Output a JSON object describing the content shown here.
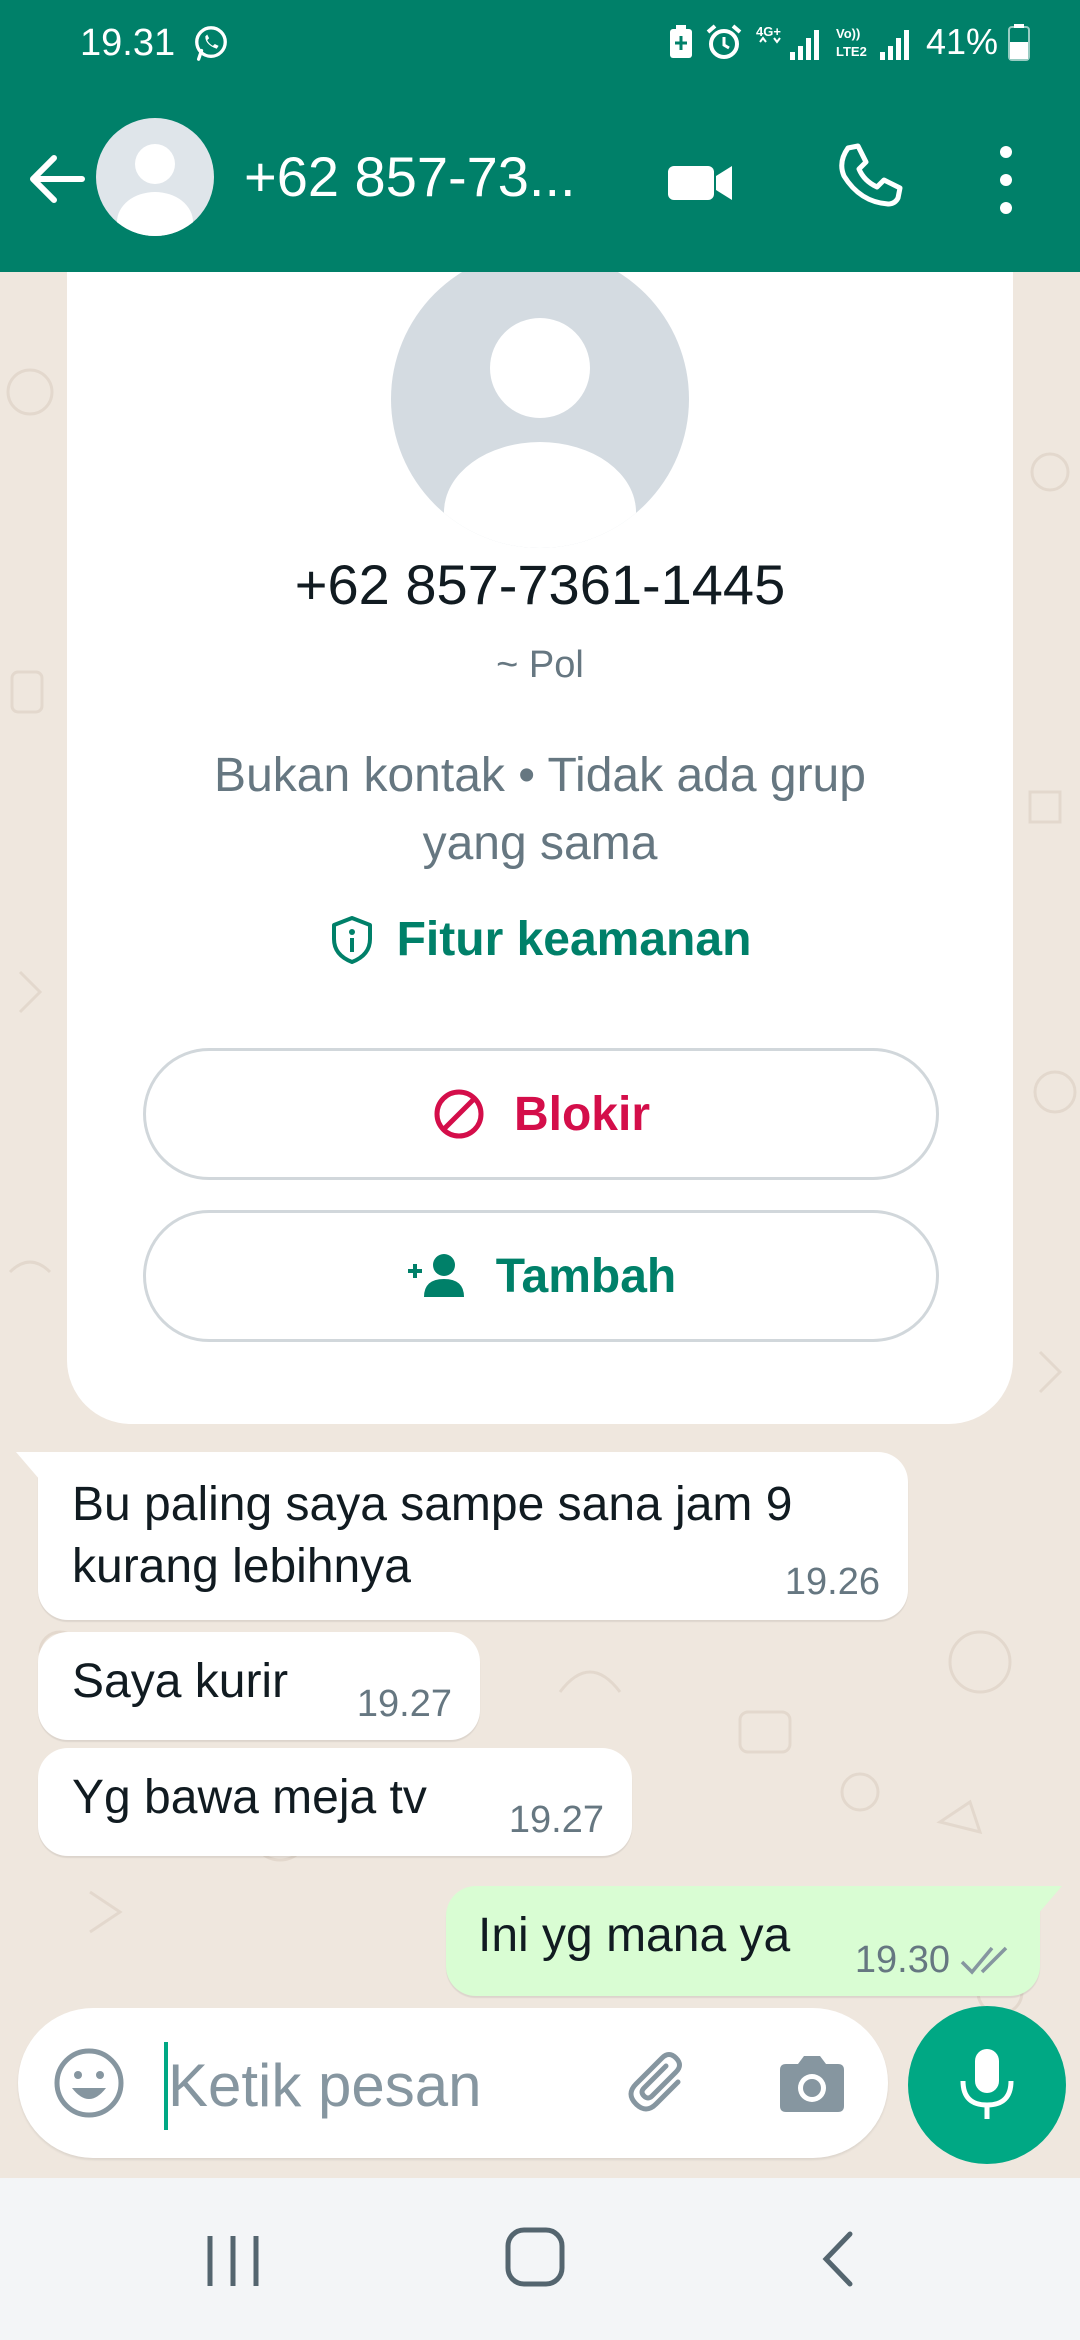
{
  "status_bar": {
    "time": "19.31",
    "battery": "41%",
    "network_1": "4G+",
    "network_2": "Vo)) LTE2"
  },
  "header": {
    "title": "+62 857-73..."
  },
  "contact_card": {
    "number": "+62 857-7361-1445",
    "push_name": "~ Pol",
    "info": "Bukan kontak • Tidak ada grup yang sama",
    "security_label": "Fitur keamanan",
    "block_label": "Blokir",
    "add_label": "Tambah"
  },
  "messages": [
    {
      "direction": "in",
      "text": "Bu paling saya sampe sana jam 9 kurang lebihnya",
      "time": "19.26"
    },
    {
      "direction": "in",
      "text": "Saya kurir",
      "time": "19.27"
    },
    {
      "direction": "in",
      "text": "Yg bawa meja tv",
      "time": "19.27"
    },
    {
      "direction": "out",
      "text": "Ini yg mana ya",
      "time": "19.30",
      "status": "read"
    }
  ],
  "composer": {
    "placeholder": "Ketik pesan"
  },
  "colors": {
    "brand_green": "#008069",
    "accent_green": "#00a884",
    "outgoing_bubble": "#d9fdd3",
    "block_red": "#d40e4a",
    "wallpaper": "#efe7de"
  },
  "icons": [
    "whatsapp-icon",
    "battery-icon",
    "alarm-icon",
    "signal-icon",
    "back-arrow-icon",
    "video-call-icon",
    "phone-icon",
    "more-vert-icon",
    "shield-icon",
    "block-icon",
    "add-person-icon",
    "double-check-icon",
    "emoji-icon",
    "paperclip-icon",
    "camera-icon",
    "mic-icon"
  ]
}
